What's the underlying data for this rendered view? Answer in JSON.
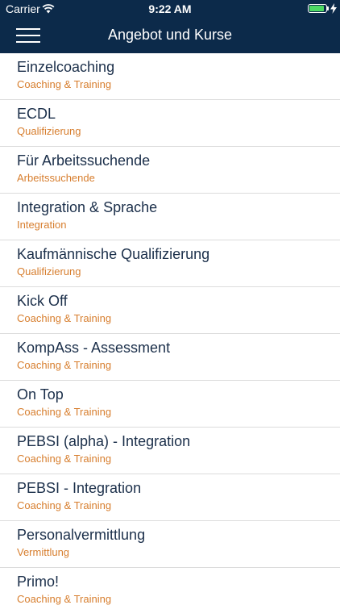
{
  "status_bar": {
    "carrier": "Carrier",
    "time": "9:22 AM",
    "wifi_icon": "wifi-icon",
    "battery_icon": "battery-icon",
    "battery_level": 0.9,
    "battery_color": "#4cd964",
    "charging_icon": "bolt-icon"
  },
  "nav": {
    "title": "Angebot und Kurse",
    "menu_icon": "hamburger-menu-icon",
    "background": "#0c2a4a"
  },
  "colors": {
    "title_text": "#1b2f4a",
    "category_text": "#d77e2e",
    "separator": "#dcdcdc"
  },
  "courses": [
    {
      "title": "Einzelcoaching",
      "category": "Coaching & Training"
    },
    {
      "title": "ECDL",
      "category": "Qualifizierung"
    },
    {
      "title": "Für Arbeitssuchende",
      "category": "Arbeitssuchende"
    },
    {
      "title": "Integration & Sprache",
      "category": "Integration"
    },
    {
      "title": "Kaufmännische Qualifizierung",
      "category": "Qualifizierung"
    },
    {
      "title": "Kick Off",
      "category": "Coaching & Training"
    },
    {
      "title": "KompAss - Assessment",
      "category": "Coaching & Training"
    },
    {
      "title": "On Top",
      "category": "Coaching & Training"
    },
    {
      "title": "PEBSI (alpha) - Integration",
      "category": "Coaching & Training"
    },
    {
      "title": "PEBSI - Integration",
      "category": "Coaching & Training"
    },
    {
      "title": "Personalvermittlung",
      "category": "Vermittlung"
    },
    {
      "title": "Primo!",
      "category": "Coaching & Training"
    }
  ]
}
